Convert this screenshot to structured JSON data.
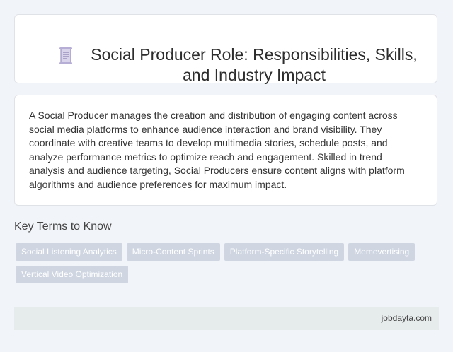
{
  "header": {
    "icon": "document-scroll-icon",
    "title": "Social Producer Role: Responsibilities, Skills, and Industry Impact"
  },
  "description": "A Social Producer manages the creation and distribution of engaging content across social media platforms to enhance audience interaction and brand visibility. They coordinate with creative teams to develop multimedia stories, schedule posts, and analyze performance metrics to optimize reach and engagement. Skilled in trend analysis and audience targeting, Social Producers ensure content aligns with platform algorithms and audience preferences for maximum impact.",
  "key_terms": {
    "heading": "Key Terms to Know",
    "tags": [
      "Social Listening Analytics",
      "Micro-Content Sprints",
      "Platform-Specific Storytelling",
      "Memevertising",
      "Vertical Video Optimization"
    ]
  },
  "footer": {
    "site": "jobdayta.com"
  },
  "colors": {
    "background": "#f1f4f8",
    "tag_background": "#cfd6e2",
    "footer_background": "#e6ebeb"
  }
}
